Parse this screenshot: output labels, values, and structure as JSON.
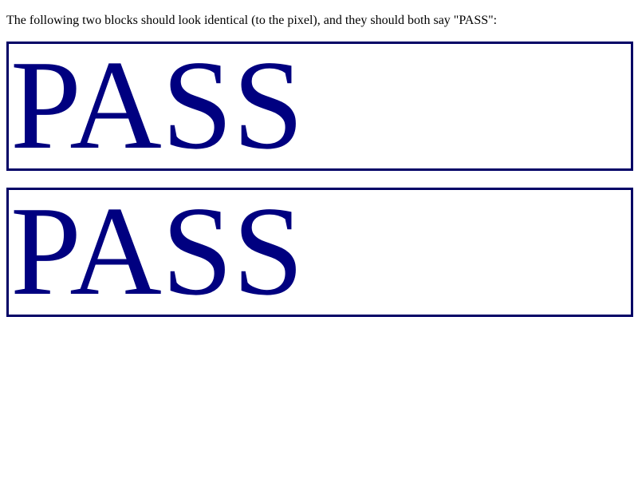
{
  "intro": {
    "text": "The following two blocks should look identical (to the pixel), and they should both say \"PASS\":"
  },
  "blocks": [
    {
      "text": "PASS"
    },
    {
      "text": "PASS"
    }
  ],
  "colors": {
    "border": "#000066",
    "text": "#000080",
    "background": "#ffffff"
  }
}
